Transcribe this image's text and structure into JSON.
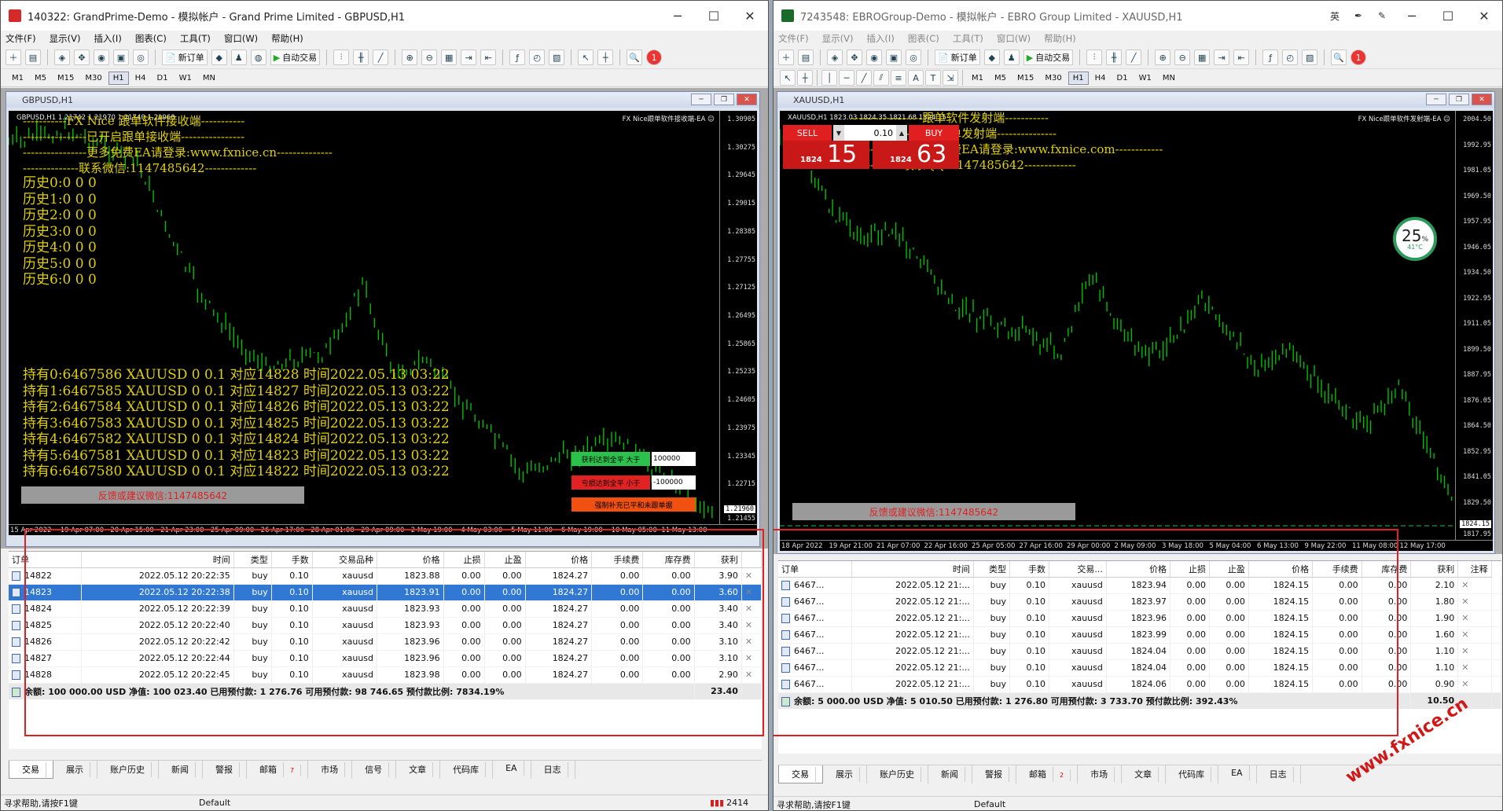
{
  "left": {
    "title": "140322: GrandPrime-Demo - 模拟帐户 - Grand Prime Limited - GBPUSD,H1",
    "menus": [
      "文件(F)",
      "显示(V)",
      "插入(I)",
      "图表(C)",
      "工具(T)",
      "窗口(W)",
      "帮助(H)"
    ],
    "toolbar": {
      "new_order": "新订单",
      "auto_trade": "自动交易"
    },
    "timeframes": [
      "M1",
      "M5",
      "M15",
      "M30",
      "H1",
      "H4",
      "D1",
      "W1",
      "MN"
    ],
    "active_tf": "H1",
    "chart_window_title": "GBPUSD,H1",
    "chart_info": "GBPUSD,H1  1.21742 1.21970 1.21740 1.21960",
    "ea_label": "FX Nice跟单软件接收端-EA ☺",
    "overlay_lines": [
      "-----------FX Nice 跟单软件接收端-----------",
      "----------------已开启跟单接收端----------------",
      "----------------更多免费EA请登录:www.fxnice.cn--------------",
      "--------------联系微信:1147485642-------------"
    ],
    "history_lines": [
      "历史0:0  0 0",
      "历史1:0  0 0",
      "历史2:0  0 0",
      "历史3:0  0 0",
      "历史4:0  0 0",
      "历史5:0  0 0",
      "历史6:0  0 0"
    ],
    "holding_lines": [
      "持有0:6467586 XAUUSD 0 0.1 对应14828 时间2022.05.13 03:22",
      "持有1:6467585 XAUUSD 0 0.1 对应14827 时间2022.05.13 03:22",
      "持有2:6467584 XAUUSD 0 0.1 对应14826 时间2022.05.13 03:22",
      "持有3:6467583 XAUUSD 0 0.1 对应14825 时间2022.05.13 03:22",
      "持有4:6467582 XAUUSD 0 0.1 对应14824 时间2022.05.13 03:22",
      "持有5:6467581 XAUUSD 0 0.1 对应14823 时间2022.05.13 03:22",
      "持有6:6467580 XAUUSD 0 0.1 对应14822 时间2022.05.13 03:22"
    ],
    "feedback": "反馈或建议微信:1147485642",
    "tp_label": "获利达到全平 大于",
    "tp_value": "100000",
    "sl_label": "亏损达到全平 小于",
    "sl_value": "-100000",
    "force_label": "强制补充已平和未跟单据",
    "price_labels": [
      "1.30905",
      "1.30275",
      "1.29645",
      "1.29015",
      "1.28385",
      "1.27755",
      "1.27125",
      "1.26495",
      "1.25865",
      "1.25235",
      "1.24605",
      "1.23975",
      "1.23345",
      "1.22715",
      "1.21960",
      "1.21455"
    ],
    "date_labels": [
      "15 Apr 2022",
      "19 Apr 07:00",
      "20 Apr 15:00",
      "21 Apr 23:00",
      "25 Apr 09:00",
      "26 Apr 17:00",
      "28 Apr 01:00",
      "29 Apr 09:00",
      "2 May 19:00",
      "4 May 03:00",
      "5 May 11:00",
      "6 May 19:00",
      "10 May 05:00",
      "11 May 13:00"
    ],
    "columns": [
      "订单",
      "时间",
      "类型",
      "手数",
      "交易品种",
      "价格",
      "止损",
      "止盈",
      "价格",
      "手续费",
      "库存费",
      "获利"
    ],
    "rows": [
      [
        "14822",
        "2022.05.12 20:22:35",
        "buy",
        "0.10",
        "xauusd",
        "1823.88",
        "0.00",
        "0.00",
        "1824.27",
        "0.00",
        "0.00",
        "3.90"
      ],
      [
        "14823",
        "2022.05.12 20:22:38",
        "buy",
        "0.10",
        "xauusd",
        "1823.91",
        "0.00",
        "0.00",
        "1824.27",
        "0.00",
        "0.00",
        "3.60"
      ],
      [
        "14824",
        "2022.05.12 20:22:39",
        "buy",
        "0.10",
        "xauusd",
        "1823.93",
        "0.00",
        "0.00",
        "1824.27",
        "0.00",
        "0.00",
        "3.40"
      ],
      [
        "14825",
        "2022.05.12 20:22:40",
        "buy",
        "0.10",
        "xauusd",
        "1823.93",
        "0.00",
        "0.00",
        "1824.27",
        "0.00",
        "0.00",
        "3.40"
      ],
      [
        "14826",
        "2022.05.12 20:22:42",
        "buy",
        "0.10",
        "xauusd",
        "1823.96",
        "0.00",
        "0.00",
        "1824.27",
        "0.00",
        "0.00",
        "3.10"
      ],
      [
        "14827",
        "2022.05.12 20:22:44",
        "buy",
        "0.10",
        "xauusd",
        "1823.96",
        "0.00",
        "0.00",
        "1824.27",
        "0.00",
        "0.00",
        "3.10"
      ],
      [
        "14828",
        "2022.05.12 20:22:45",
        "buy",
        "0.10",
        "xauusd",
        "1823.98",
        "0.00",
        "0.00",
        "1824.27",
        "0.00",
        "0.00",
        "2.90"
      ]
    ],
    "selected_row": 1,
    "summary": "余额: 100 000.00 USD  净值: 100 023.40  已用预付款: 1 276.76  可用预付款: 98 746.65  预付款比例: 7834.19%",
    "summary_total": "23.40",
    "tabs": [
      "交易",
      "展示",
      "账户历史",
      "新闻",
      "警报",
      "邮箱",
      "市场",
      "信号",
      "文章",
      "代码库",
      "EA",
      "日志"
    ],
    "mail_badge": "7",
    "status_help": "寻求帮助,请按F1键",
    "status_profile": "Default",
    "status_conn": "2414"
  },
  "right": {
    "title": "7243548: EBROGroup-Demo - 模拟帐户 - EBRO Group Limited - XAUUSD,H1",
    "title_extra": "英",
    "menus": [
      "文件(F)",
      "显示(V)",
      "插入(I)",
      "图表(C)",
      "工具(T)",
      "窗口(W)",
      "帮助(H)"
    ],
    "toolbar": {
      "new_order": "新订单",
      "auto_trade": "自动交易"
    },
    "timeframes": [
      "M1",
      "M5",
      "M15",
      "M30",
      "H1",
      "H4",
      "D1",
      "W1",
      "MN"
    ],
    "active_tf": "H1",
    "chart_window_title": "XAUUSD,H1",
    "chart_info": "XAUUSD,H1  1823.03 1824.35 1821.68 1824.15",
    "ea_label": "FX Nice跟单软件发射端-EA ☺",
    "overlay_lines": [
      "------------------跟单软件发射端-----------",
      "----------------开启跟单发射端---------------",
      "----------------更多免费EA请登录:www.fxnice.com------------",
      "-------------联系QQ:1147485642-------------"
    ],
    "sell_label": "SELL",
    "buy_label": "BUY",
    "lot": "0.10",
    "sell_price_small": "1824",
    "sell_price_big": "15",
    "buy_price_small": "1824",
    "buy_price_big": "63",
    "gauge_pct": "25",
    "gauge_unit": "%",
    "gauge_temp": "41°C",
    "feedback": "反馈或建议微信:1147485642",
    "price_labels": [
      "2004.50",
      "1992.95",
      "1981.05",
      "1969.50",
      "1957.95",
      "1946.05",
      "1934.50",
      "1922.95",
      "1911.05",
      "1899.50",
      "1887.95",
      "1876.05",
      "1864.50",
      "1852.95",
      "1841.05",
      "1829.50",
      "1824.15",
      "1817.95"
    ],
    "date_labels": [
      "18 Apr 2022",
      "19 Apr 21:00",
      "21 Apr 07:00",
      "22 Apr 16:00",
      "25 Apr 05:00",
      "27 Apr 16:00",
      "29 Apr 00:00",
      "2 May 09:00",
      "3 May 18:00",
      "5 May 04:00",
      "6 May 13:00",
      "9 May 22:00",
      "11 May 08:00",
      "12 May 17:00"
    ],
    "columns": [
      "订单",
      "时间",
      "类型",
      "手数",
      "交易...",
      "价格",
      "止损",
      "止盈",
      "价格",
      "手续费",
      "库存费",
      "获利",
      "注释"
    ],
    "rows": [
      [
        "6467...",
        "2022.05.12 21:...",
        "buy",
        "0.10",
        "xauusd",
        "1823.94",
        "0.00",
        "0.00",
        "1824.15",
        "0.00",
        "0.00",
        "2.10"
      ],
      [
        "6467...",
        "2022.05.12 21:...",
        "buy",
        "0.10",
        "xauusd",
        "1823.97",
        "0.00",
        "0.00",
        "1824.15",
        "0.00",
        "0.00",
        "1.80"
      ],
      [
        "6467...",
        "2022.05.12 21:...",
        "buy",
        "0.10",
        "xauusd",
        "1823.96",
        "0.00",
        "0.00",
        "1824.15",
        "0.00",
        "0.00",
        "1.90"
      ],
      [
        "6467...",
        "2022.05.12 21:...",
        "buy",
        "0.10",
        "xauusd",
        "1823.99",
        "0.00",
        "0.00",
        "1824.15",
        "0.00",
        "0.00",
        "1.60"
      ],
      [
        "6467...",
        "2022.05.12 21:...",
        "buy",
        "0.10",
        "xauusd",
        "1824.04",
        "0.00",
        "0.00",
        "1824.15",
        "0.00",
        "0.00",
        "1.10"
      ],
      [
        "6467...",
        "2022.05.12 21:...",
        "buy",
        "0.10",
        "xauusd",
        "1824.04",
        "0.00",
        "0.00",
        "1824.15",
        "0.00",
        "0.00",
        "1.10"
      ],
      [
        "6467...",
        "2022.05.12 21:...",
        "buy",
        "0.10",
        "xauusd",
        "1824.06",
        "0.00",
        "0.00",
        "1824.15",
        "0.00",
        "0.00",
        "0.90"
      ]
    ],
    "summary": "余额: 5 000.00 USD  净值: 5 010.50  已用预付款: 1 276.80  可用预付款: 3 733.70  预付款比例: 392.43%",
    "summary_total": "10.50",
    "tabs": [
      "交易",
      "展示",
      "账户历史",
      "新闻",
      "警报",
      "邮箱",
      "市场",
      "文章",
      "代码库",
      "EA",
      "日志"
    ],
    "mail_badge": "2",
    "status_help": "寻求帮助,请按F1键",
    "status_profile": "Default"
  },
  "watermark": "www.fxnice.cn",
  "colors": {
    "candle": "#00c000",
    "overlay_text": "#e0d000",
    "highlight": "#e02020",
    "selected_row": "#3078d4"
  }
}
